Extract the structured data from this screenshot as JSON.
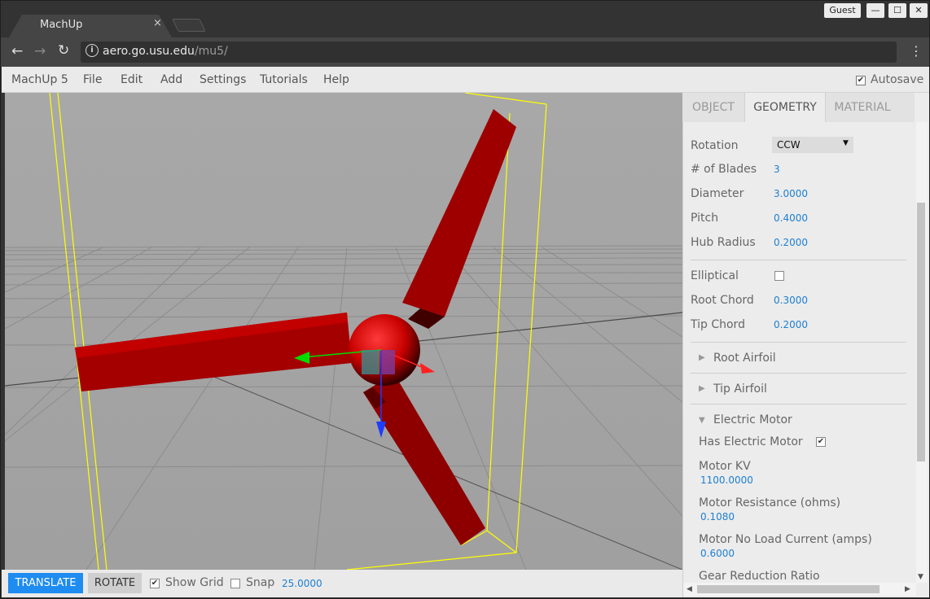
{
  "browser": {
    "tab_title": "MachUp",
    "tab_close": "×",
    "profile": "Guest",
    "url_host": "aero.go.usu.edu",
    "url_path": "/mu5/",
    "window_buttons": [
      "—",
      "☐",
      "✕"
    ]
  },
  "menubar": {
    "items": [
      "MachUp 5",
      "File",
      "Edit",
      "Add",
      "Settings",
      "Tutorials",
      "Help"
    ],
    "autosave_label": "Autosave",
    "autosave_checked": true
  },
  "bottombar": {
    "translate_label": "TRANSLATE",
    "rotate_label": "ROTATE",
    "show_grid_label": "Show Grid",
    "show_grid_checked": true,
    "snap_label": "Snap",
    "snap_checked": false,
    "snap_value": "25.0000"
  },
  "panel": {
    "tabs": [
      "OBJECT",
      "GEOMETRY",
      "MATERIAL"
    ],
    "active_tab": "GEOMETRY",
    "geometry": {
      "rotation_label": "Rotation",
      "rotation_value": "CCW",
      "blades_label": "# of Blades",
      "blades_value": "3",
      "diameter_label": "Diameter",
      "diameter_value": "3.0000",
      "pitch_label": "Pitch",
      "pitch_value": "0.4000",
      "hub_radius_label": "Hub Radius",
      "hub_radius_value": "0.2000",
      "elliptical_label": "Elliptical",
      "elliptical_checked": false,
      "root_chord_label": "Root Chord",
      "root_chord_value": "0.3000",
      "tip_chord_label": "Tip Chord",
      "tip_chord_value": "0.2000"
    },
    "sections": {
      "root_airfoil": "Root Airfoil",
      "tip_airfoil": "Tip Airfoil",
      "electric_motor": "Electric Motor"
    },
    "motor": {
      "has_motor_label": "Has Electric Motor",
      "has_motor_checked": true,
      "kv_label": "Motor KV",
      "kv_value": "1100.0000",
      "resistance_label": "Motor Resistance (ohms)",
      "resistance_value": "0.1080",
      "no_load_label": "Motor No Load Current (amps)",
      "no_load_value": "0.6000",
      "gear_label": "Gear Reduction Ratio"
    }
  },
  "colors": {
    "accent": "#1e8cf0",
    "value_text": "#1e7fd0",
    "propeller": "#b30000",
    "bounding_box": "#ffff00"
  }
}
